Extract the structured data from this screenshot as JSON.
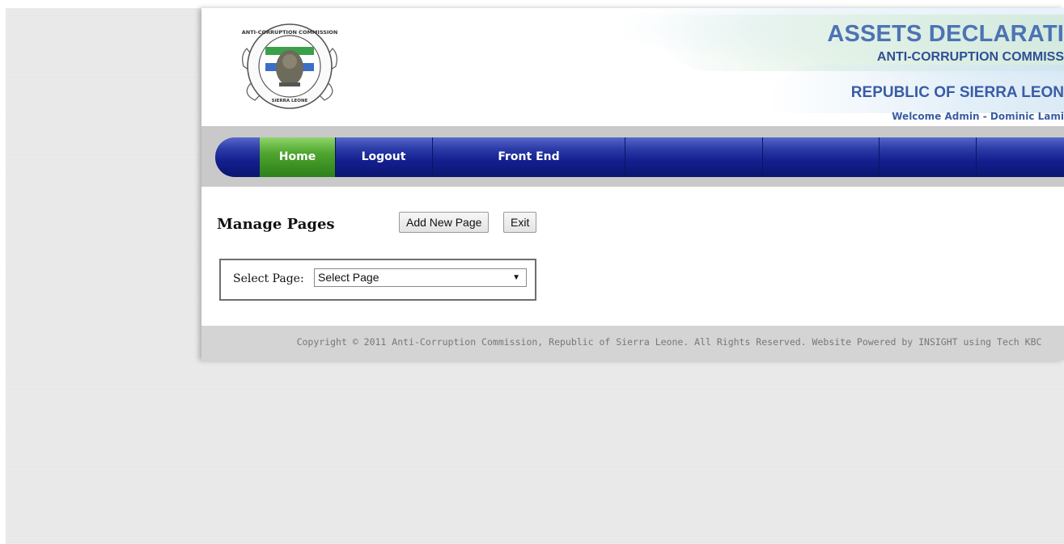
{
  "header": {
    "title": "ASSETS DECLARATI",
    "subtitle": "ANTI-CORRUPTION COMMISS",
    "republic": "REPUBLIC OF SIERRA LEON",
    "welcome": "Welcome Admin - Dominic Lami",
    "logo_text": {
      "top": "ANTI-CORRUPTION COMMISSION",
      "bottom": "SIERRA LEONE"
    }
  },
  "nav": {
    "items": [
      {
        "label": "Home",
        "active": true
      },
      {
        "label": "Logout",
        "active": false
      },
      {
        "label": "Front End",
        "active": false
      }
    ]
  },
  "content": {
    "title": "Manage Pages",
    "add_button": "Add New Page",
    "exit_button": "Exit",
    "select_label": "Select Page:",
    "select_value": "Select Page"
  },
  "footer": {
    "copyright": "Copyright © 2011 Anti-Corruption Commission, Republic of Sierra Leone. All Rights Reserved. Website Powered by INSIGHT using Tech KBC"
  },
  "colors": {
    "nav_blue": "#141f8e",
    "nav_active_green": "#4fa52e",
    "header_blue": "#4d73b4"
  }
}
